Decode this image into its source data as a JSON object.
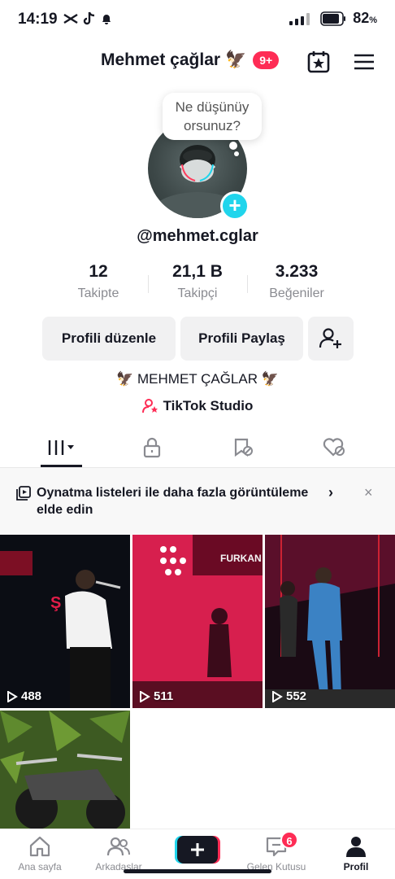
{
  "status": {
    "time": "14:19",
    "battery": "82",
    "battery_unit": "%"
  },
  "header": {
    "title": "Mehmet çağlar",
    "title_emoji": "🦅",
    "notif_badge": "9+"
  },
  "profile": {
    "bubble": "Ne düşünüy orsunuz?",
    "username": "@mehmet.cglar",
    "stats": [
      {
        "value": "12",
        "label": "Takipte"
      },
      {
        "value": "21,1 B",
        "label": "Takipçi"
      },
      {
        "value": "3.233",
        "label": "Beğeniler"
      }
    ],
    "edit_button": "Profili düzenle",
    "share_button": "Profili Paylaş",
    "bio": "🦅 MEHMET ÇAĞLAR 🦅",
    "studio": "TikTok Studio"
  },
  "promo": {
    "text": "Oynatma listeleri ile daha fazla görüntüleme elde edin",
    "chevron": "›",
    "close": "×"
  },
  "videos": [
    {
      "views": "488"
    },
    {
      "views": "511"
    },
    {
      "views": "552"
    },
    {
      "views": ""
    }
  ],
  "nav": {
    "home": "Ana sayfa",
    "friends": "Arkadaşlar",
    "inbox": "Gelen Kutusu",
    "inbox_badge": "6",
    "profile": "Profil"
  },
  "colors": {
    "accent": "#fe2c55",
    "cyan": "#20d5ec",
    "text": "#161823",
    "muted": "#8a8b91"
  }
}
